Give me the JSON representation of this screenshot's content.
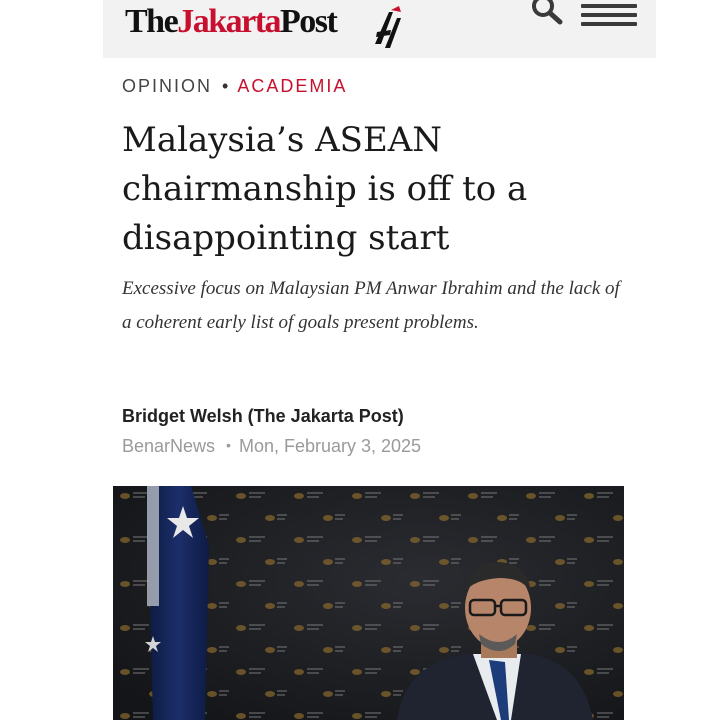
{
  "header": {
    "logo_part1": "The",
    "logo_part2": "Jakarta",
    "logo_part3": "Post",
    "icons": [
      "search-icon",
      "menu-icon"
    ],
    "colors": {
      "brand_red": "#c8102e",
      "header_bg": "#f2f2f2"
    }
  },
  "article": {
    "section": "OPINION",
    "subsection": "ACADEMIA",
    "separator": "•",
    "title": "Malaysia’s ASEAN chairmanship is off to a disappointing start",
    "summary": "Excessive focus on Malaysian PM Anwar Ibrahim and the lack of a coherent early list of goals present problems.",
    "author": "Bridget Welsh (The Jakarta Post)",
    "source": "BenarNews",
    "date": "Mon, February 3, 2025"
  }
}
